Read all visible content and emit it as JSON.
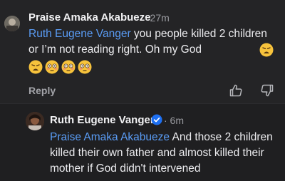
{
  "comment1": {
    "author": "Praise Amaka Akabueze",
    "time": "· 27m",
    "mention": "Ruth Eugene Vanger",
    "text": " you people killed 2 children or I’m not reading right. Oh my God",
    "emojis": [
      "weary-face",
      "flushed-face",
      "flushed-face",
      "flushed-face"
    ],
    "trailing_emoji": "weary-face",
    "reply_label": "Reply"
  },
  "comment2": {
    "author": "Ruth Eugene Vanger",
    "time": "· 6m",
    "mention": "Praise Amaka Akabueze",
    "text": " And those 2 children killed their own father and almost killed their mother if God didn't intervened"
  },
  "colors": {
    "background": "#1f1f21",
    "mention": "#5a9cf5",
    "verified": "#1d6ff2"
  }
}
